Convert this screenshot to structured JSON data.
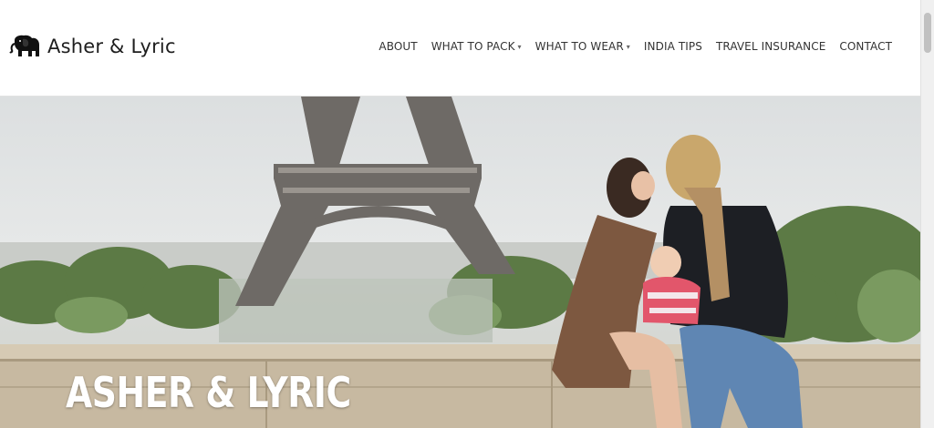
{
  "header": {
    "logo_text": "Asher & Lyric",
    "logo_icon": "elephant-icon"
  },
  "nav": {
    "items": [
      {
        "label": "ABOUT",
        "dropdown": false
      },
      {
        "label": "WHAT TO PACK",
        "dropdown": true
      },
      {
        "label": "WHAT TO WEAR",
        "dropdown": true
      },
      {
        "label": "INDIA TIPS",
        "dropdown": false
      },
      {
        "label": "TRAVEL INSURANCE",
        "dropdown": false
      },
      {
        "label": "CONTACT",
        "dropdown": false
      }
    ]
  },
  "hero": {
    "title": "ASHER & LYRIC"
  }
}
